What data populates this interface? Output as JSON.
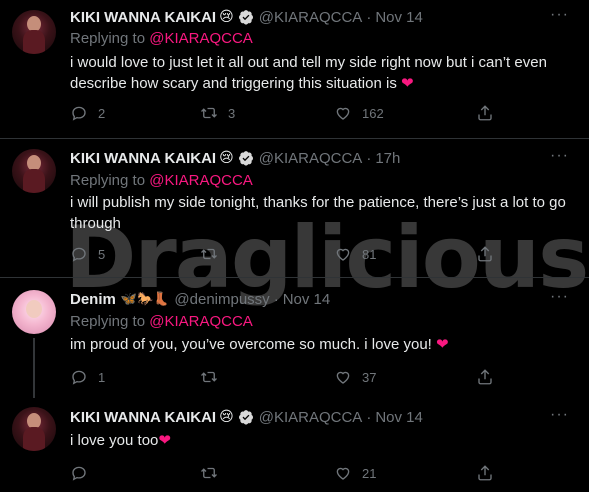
{
  "watermark": "Draglicious",
  "tweets": [
    {
      "name": "KIKI WANNA KAIKAI",
      "emoji": "😢",
      "handle": "@KIARAQCCA",
      "dot": "·",
      "time": "Nov 14",
      "replying_label": "Replying to",
      "replying_to": "@KIARAQCCA",
      "text": "i would love to just let it all out and tell my side right now but i can’t even describe how scary and triggering this situation is",
      "heart_emoji": "❤",
      "replies": "2",
      "retweets": "3",
      "likes": "162"
    },
    {
      "name": "KIKI WANNA KAIKAI",
      "emoji": "😢",
      "handle": "@KIARAQCCA",
      "dot": "·",
      "time": "17h",
      "replying_label": "Replying to",
      "replying_to": "@KIARAQCCA",
      "text": "i will publish my side tonight, thanks for the patience, there’s just a lot to go through",
      "replies": "5",
      "retweets": "",
      "likes": "81"
    },
    {
      "name": "Denim",
      "emoji": "🦋🐎👢",
      "handle": "@denimpussy",
      "dot": "·",
      "time": "Nov 14",
      "replying_label": "Replying to",
      "replying_to": "@KIARAQCCA",
      "text": "im proud of you, you’ve overcome so much. i love you!",
      "heart_emoji": "❤",
      "replies": "1",
      "retweets": "",
      "likes": "37"
    },
    {
      "name": "KIKI WANNA KAIKAI",
      "emoji": "😢",
      "handle": "@KIARAQCCA",
      "dot": "·",
      "time": "Nov 14",
      "text": "i love you too",
      "heart_emoji": "❤",
      "replies": "",
      "retweets": "",
      "likes": "21"
    }
  ],
  "menu_glyph": "···",
  "colors": {
    "background": "#000000",
    "mention": "#f91880",
    "muted": "#71767b",
    "verified": "#d9d9d9"
  }
}
